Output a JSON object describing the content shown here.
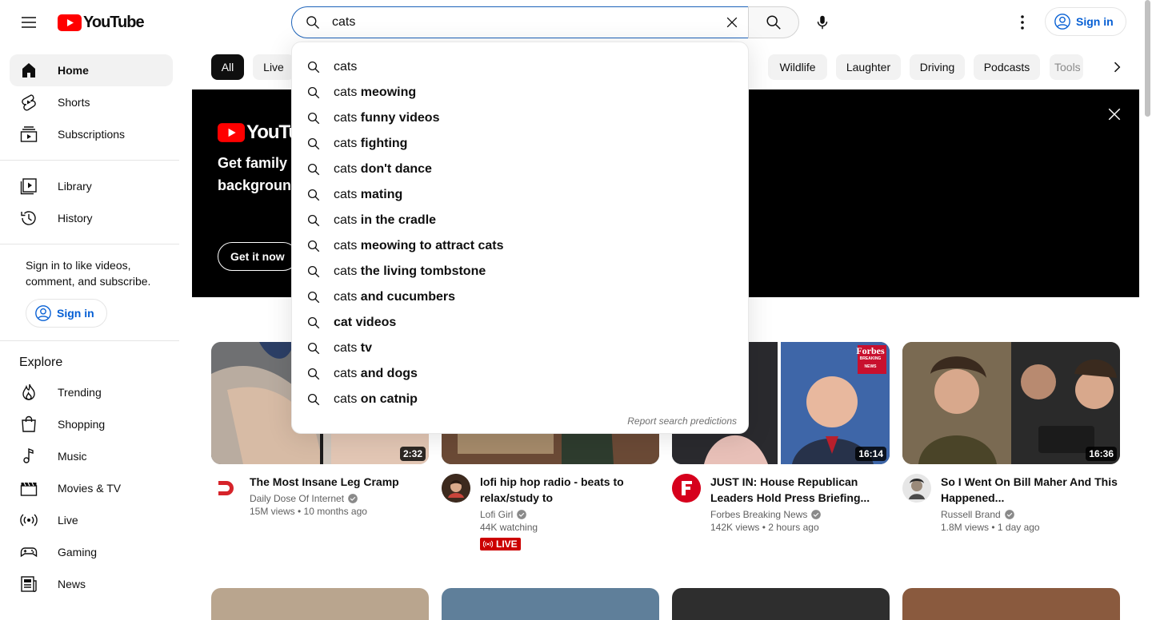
{
  "header": {
    "logo_text": "YouTube",
    "search_value": "cats",
    "signin_label": "Sign in"
  },
  "sidebar": {
    "primary": [
      {
        "label": "Home",
        "icon": "home-icon"
      },
      {
        "label": "Shorts",
        "icon": "shorts-icon"
      },
      {
        "label": "Subscriptions",
        "icon": "subscriptions-icon"
      }
    ],
    "secondary": [
      {
        "label": "Library",
        "icon": "library-icon"
      },
      {
        "label": "History",
        "icon": "history-icon"
      }
    ],
    "signin_note": "Sign in to like videos, comment, and subscribe.",
    "signin_label": "Sign in",
    "explore_heading": "Explore",
    "explore": [
      {
        "label": "Trending",
        "icon": "trending-icon"
      },
      {
        "label": "Shopping",
        "icon": "shopping-icon"
      },
      {
        "label": "Music",
        "icon": "music-icon"
      },
      {
        "label": "Movies & TV",
        "icon": "movies-icon"
      },
      {
        "label": "Live",
        "icon": "live-icon"
      },
      {
        "label": "Gaming",
        "icon": "gaming-icon"
      },
      {
        "label": "News",
        "icon": "news-icon"
      }
    ]
  },
  "chips": [
    "All",
    "Live",
    "Wildlife",
    "Laughter",
    "Driving",
    "Podcasts",
    "Tools"
  ],
  "banner": {
    "logo_text": "YouTube",
    "headline_1": "Get family",
    "headline_2": "background",
    "cta_label": "Get it now"
  },
  "suggestions": {
    "query": "cats",
    "items": [
      {
        "prefix": "cats",
        "rest": ""
      },
      {
        "prefix": "cats",
        "rest": " meowing"
      },
      {
        "prefix": "cats",
        "rest": " funny videos"
      },
      {
        "prefix": "cats",
        "rest": " fighting"
      },
      {
        "prefix": "cats",
        "rest": " don't dance"
      },
      {
        "prefix": "cats",
        "rest": " mating"
      },
      {
        "prefix": "cats",
        "rest": " in the cradle"
      },
      {
        "prefix": "cats",
        "rest": " meowing to attract cats"
      },
      {
        "prefix": "cats",
        "rest": " the living tombstone"
      },
      {
        "prefix": "cats",
        "rest": " and cucumbers"
      },
      {
        "prefix": "",
        "rest": "cat videos"
      },
      {
        "prefix": "cats",
        "rest": " tv"
      },
      {
        "prefix": "cats",
        "rest": " and dogs"
      },
      {
        "prefix": "cats",
        "rest": " on catnip"
      }
    ],
    "report_label": "Report search predictions"
  },
  "videos": [
    {
      "title": "The Most Insane Leg Cramp",
      "channel": "Daily Dose Of Internet",
      "stats": "15M views • 10 months ago",
      "duration": "2:32"
    },
    {
      "title": "lofi hip hop radio - beats to relax/study to",
      "channel": "Lofi Girl",
      "stats": "44K watching",
      "live_label": "LIVE"
    },
    {
      "title": "JUST IN: House Republican Leaders Hold Press Briefing...",
      "channel": "Forbes Breaking News",
      "stats": "142K views • 2 hours ago",
      "duration": "16:14",
      "thumb_badge": "Forbes",
      "thumb_badge_sub": "BREAKING NEWS"
    },
    {
      "title": "So I Went On Bill Maher And This Happened...",
      "channel": "Russell Brand",
      "stats": "1.8M views • 1 day ago",
      "duration": "16:36"
    }
  ],
  "colors": {
    "brand_red": "#ff0000",
    "link_blue": "#065fd4",
    "search_focus": "#1c62b9",
    "live_red": "#cc0000"
  }
}
